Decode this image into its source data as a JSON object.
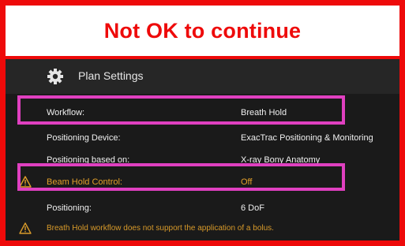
{
  "banner": {
    "text": "Not OK to continue"
  },
  "header": {
    "title": "Plan Settings",
    "icon": "gear-icon"
  },
  "settings": [
    {
      "label": "Workflow:",
      "value": "Breath Hold",
      "warning": false,
      "highlighted": true
    },
    {
      "label": "Positioning Device:",
      "value": "ExacTrac Positioning & Monitoring",
      "warning": false,
      "highlighted": false
    },
    {
      "label": "Positioning based on:",
      "value": "X-ray Bony Anatomy",
      "warning": false,
      "highlighted": false
    },
    {
      "label": "Beam Hold Control:",
      "value": "Off",
      "warning": true,
      "highlighted": true
    },
    {
      "label": "Positioning:",
      "value": "6 DoF",
      "warning": false,
      "highlighted": false
    }
  ],
  "footer": {
    "message": "Breath Hold workflow does not support the application of a bolus.",
    "icon": "warning-icon"
  },
  "colors": {
    "alert_red": "#ee0a0a",
    "highlight_magenta": "#e040c0",
    "warning_amber": "#e3a02a",
    "panel_bg": "#1a1a1a"
  }
}
